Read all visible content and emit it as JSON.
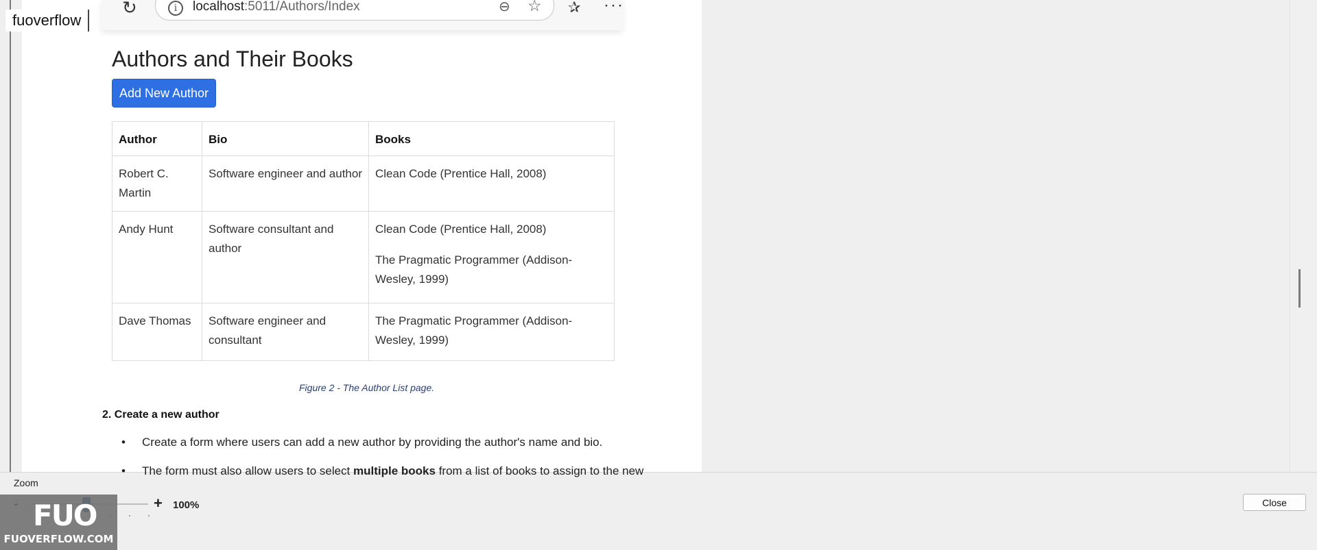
{
  "app": {
    "name": "fuoverflow"
  },
  "browser": {
    "url_host": "localhost",
    "url_rest": ":5011/Authors/Index",
    "icons": [
      "reload-icon",
      "info-icon",
      "zoom-out-icon",
      "star-icon",
      "favorites-list-icon",
      "more-icon"
    ]
  },
  "page": {
    "heading": "Authors and Their Books",
    "add_button_label": "Add New Author",
    "table": {
      "headers": [
        "Author",
        "Bio",
        "Books"
      ],
      "rows": [
        {
          "author": "Robert C. Martin",
          "bio": "Software engineer and author",
          "books": [
            "Clean Code (Prentice Hall, 2008)"
          ]
        },
        {
          "author": "Andy Hunt",
          "bio": "Software consultant and author",
          "books": [
            "Clean Code (Prentice Hall, 2008)",
            "The Pragmatic Programmer (Addison-Wesley, 1999)"
          ]
        },
        {
          "author": "Dave Thomas",
          "bio": "Software engineer and consultant",
          "books": [
            "The Pragmatic Programmer (Addison-Wesley, 1999)"
          ]
        }
      ]
    },
    "figure_caption": "Figure 2 - The Author List page.",
    "section_heading": "2. Create a new author",
    "bullets": [
      {
        "text": "Create a form where users can add a new author by providing the author's name and bio.",
        "bold": ""
      },
      {
        "pre": "The form must also allow users to select ",
        "bold": "multiple books",
        "post": " from a list of books to assign to the new"
      }
    ]
  },
  "zoom": {
    "label": "Zoom",
    "minus": "-",
    "plus": "+",
    "value": "100%",
    "level_fraction": 0.47
  },
  "close_label": "Close",
  "watermark": {
    "mark": "FUO",
    "text": "FUOVERFLOW.COM"
  }
}
